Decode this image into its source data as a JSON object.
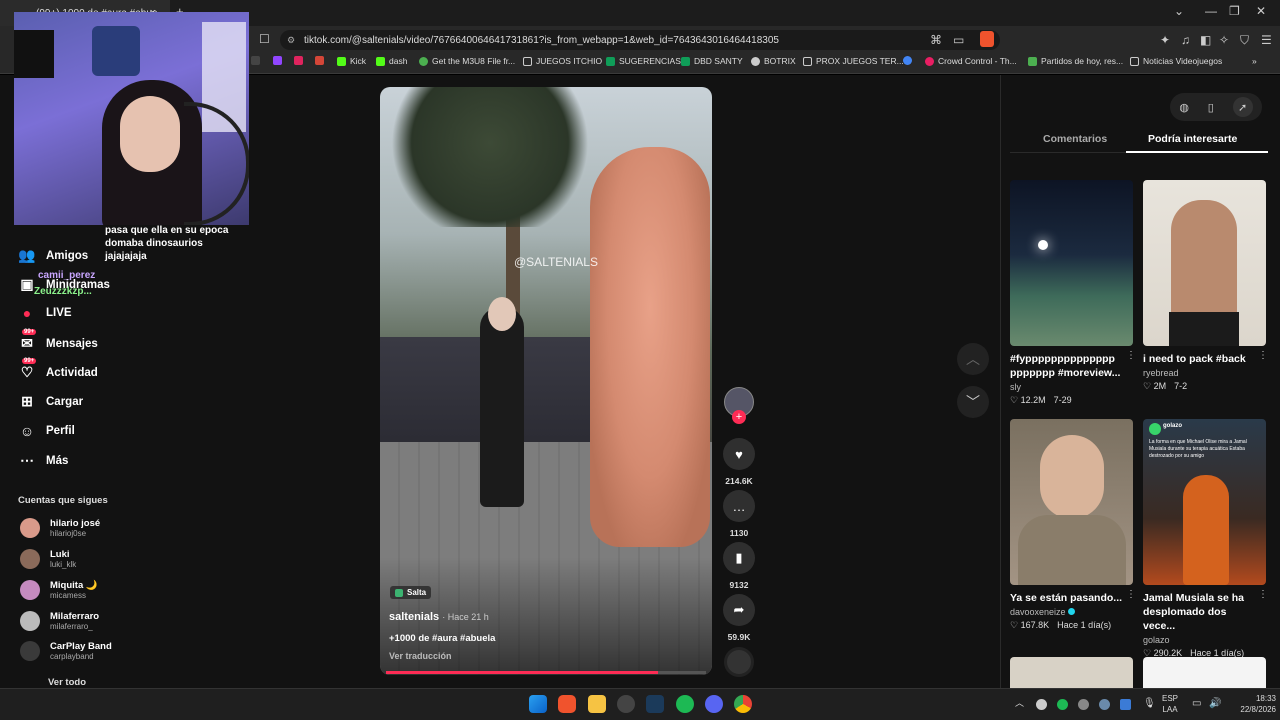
{
  "browser": {
    "tab_title": "(99+) 1000 de #aura #abue",
    "url": "tiktok.com/@saltenials/video/7676640064641731861?is_from_webapp=1&web_id=7643643016464418305",
    "bookmarks": [
      "Kick",
      "dash",
      "Get the M3U8 File fr...",
      "JUEGOS ITCHIO",
      "SUGERENCIAS",
      "DBD SANTY",
      "BOTRIX",
      "PROX JUEGOS TER...",
      "Crowd Control - Th...",
      "Partidos de hoy, res...",
      "Noticias Videojuegos"
    ]
  },
  "sidebar": {
    "items": [
      {
        "label": "Amigos",
        "icon": "friends-icon"
      },
      {
        "label": "Minidramas",
        "icon": "minidramas-icon"
      },
      {
        "label": "LIVE",
        "icon": "live-icon"
      },
      {
        "label": "Mensajes",
        "icon": "messages-icon",
        "badge": "99+"
      },
      {
        "label": "Actividad",
        "icon": "activity-icon",
        "badge": "99+"
      },
      {
        "label": "Cargar",
        "icon": "upload-icon"
      },
      {
        "label": "Perfil",
        "icon": "profile-icon"
      },
      {
        "label": "Más",
        "icon": "more-icon"
      }
    ],
    "following_title": "Cuentas que sigues",
    "following": [
      {
        "name": "hilario josé",
        "handle": "hilarioj0se",
        "color": "#d99a8a"
      },
      {
        "name": "Luki",
        "handle": "luki_klk",
        "color": "#8a6a5a"
      },
      {
        "name": "Miquita 🌙",
        "handle": "micamess",
        "color": "#c58abf"
      },
      {
        "name": "Milaferraro",
        "handle": "milaferraro_",
        "color": "#bbbbbb"
      },
      {
        "name": "CarPlay Band",
        "handle": "carplayband",
        "color": "#3a3a3a"
      }
    ],
    "see_all": "Ver todo"
  },
  "chat": {
    "lines": [
      {
        "user": "",
        "text": "pasa que ella en su epoca domaba dinosaurios jajajajaja"
      },
      {
        "user": "camii_perez",
        "text": ""
      },
      {
        "user": "Zeuzzzkzp...",
        "text": ""
      }
    ]
  },
  "video": {
    "watermark": "@SALTENIALS",
    "location": "Salta",
    "author": "saltenials",
    "time": "Hace 21 h",
    "caption": "+1000 de #aura #abuela",
    "translate": "Ver traducción",
    "progress": 0.85
  },
  "actions": {
    "likes": "214.6K",
    "comments": "1130",
    "saves": "9132",
    "shares": "59.9K"
  },
  "right": {
    "tabs": [
      "Comentarios",
      "Podría interesarte"
    ],
    "active_tab": 1,
    "cards": [
      {
        "title": "#fypppppppppppppp ppppppp #moreview...",
        "user": "sly",
        "views": "12.2M",
        "date": "7-29",
        "verified": false
      },
      {
        "title": "i need to pack #back",
        "user": "ryebread",
        "views": "2M",
        "date": "7-2",
        "verified": false
      },
      {
        "title": "Ya se están pasando...",
        "user": "davooxeneize",
        "views": "167.8K",
        "date": "Hace 1 día(s)",
        "verified": true
      },
      {
        "title": "Jamal Musiala se ha desplomado dos vece...",
        "user": "golazo",
        "views": "290.2K",
        "date": "Hace 1 día(s)",
        "verified": false
      }
    ],
    "card4_overlay": "La forma en que Michael Olise mira a Jamal Musiala durante su terapia acuática Estaba destrozado por su amigo",
    "card4_brand": "golazo"
  },
  "taskbar": {
    "lang": "ESP",
    "lang2": "LAA",
    "time": "18:33",
    "date": "22/8/2026"
  }
}
